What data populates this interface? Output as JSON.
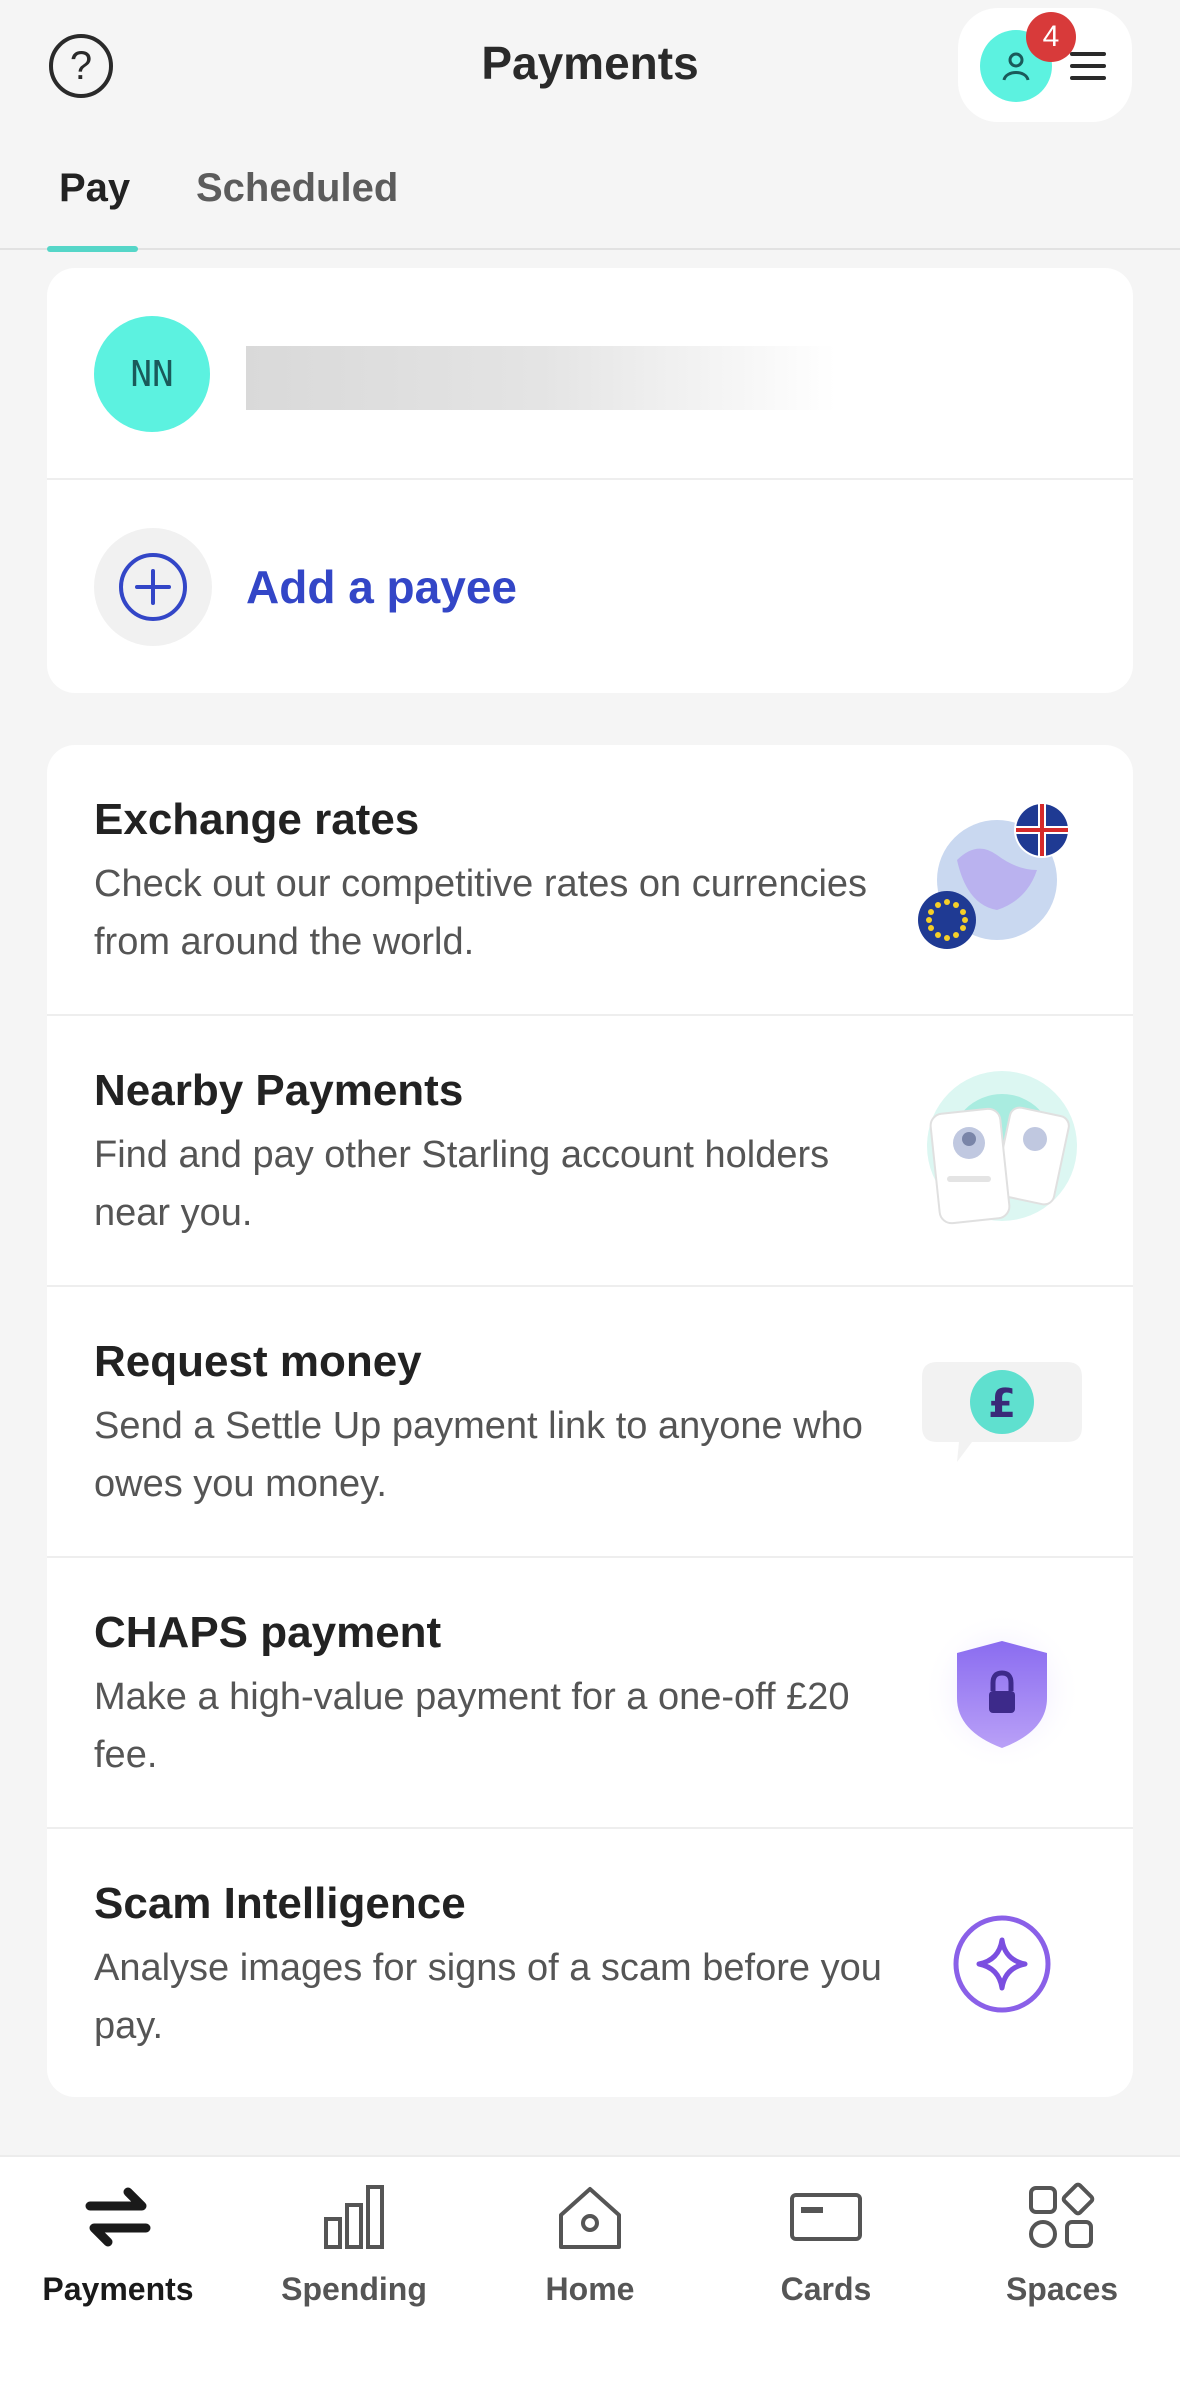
{
  "header": {
    "title": "Payments",
    "help_icon": "question-icon",
    "notification_count": "4"
  },
  "tabs": [
    {
      "label": "Pay",
      "active": true
    },
    {
      "label": "Scheduled",
      "active": false
    }
  ],
  "payees": {
    "items": [
      {
        "initials": "NN"
      }
    ],
    "add_label": "Add a payee"
  },
  "features": [
    {
      "title": "Exchange rates",
      "description": "Check out our competitive rates on currencies from around the world.",
      "icon": "globe-flags-icon"
    },
    {
      "title": "Nearby Payments",
      "description": "Find and pay other Starling account holders near you.",
      "icon": "nearby-phones-icon"
    },
    {
      "title": "Request money",
      "description": "Send a Settle Up payment link to anyone who owes you money.",
      "icon": "pound-speech-bubble-icon"
    },
    {
      "title": "CHAPS payment",
      "description": "Make a high-value payment for a one-off £20 fee.",
      "icon": "shield-lock-icon"
    },
    {
      "title": "Scam Intelligence",
      "description": "Analyse images for signs of a scam before you pay.",
      "icon": "sparkle-circle-icon"
    }
  ],
  "bottom_nav": [
    {
      "label": "Payments",
      "icon": "transfer-arrows-icon",
      "active": true
    },
    {
      "label": "Spending",
      "icon": "bar-chart-icon",
      "active": false
    },
    {
      "label": "Home",
      "icon": "home-icon",
      "active": false
    },
    {
      "label": "Cards",
      "icon": "card-icon",
      "active": false
    },
    {
      "label": "Spaces",
      "icon": "spaces-grid-icon",
      "active": false
    }
  ],
  "colors": {
    "accent_teal": "#5cf2e0",
    "link_blue": "#3346c7",
    "badge_red": "#d83a3a",
    "purple": "#7b4fe0"
  }
}
